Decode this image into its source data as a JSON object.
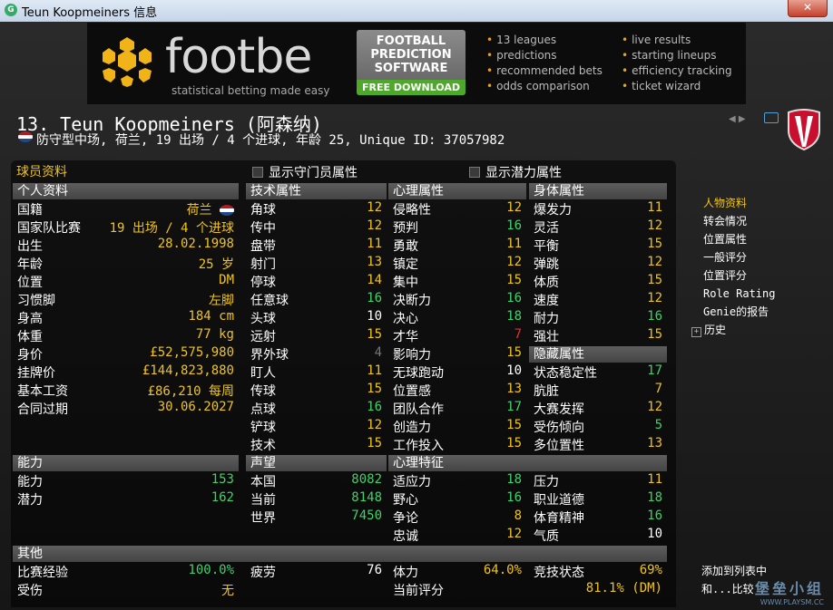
{
  "window": {
    "title": "Teun Koopmeiners 信息",
    "close_glyph": "✕",
    "app_icon_text": "G"
  },
  "banner": {
    "brand": "footbe",
    "tagline": "statistical betting made easy",
    "ad_lines": [
      "FOOTBALL",
      "PREDICTION",
      "SOFTWARE"
    ],
    "ad_download": "FREE DOWNLOAD",
    "features_left": [
      "13 leagues",
      "predictions",
      "recommended bets",
      "odds comparison"
    ],
    "features_right": [
      "live results",
      "starting lineups",
      "efficiency tracking",
      "ticket wizard"
    ]
  },
  "player": {
    "title": "13. Teun Koopmeiners (阿森纳)",
    "info": "防守型中场, 荷兰, 19 出场 / 4 个进球, 年龄 25, Unique ID: 37057982"
  },
  "section_title": "球员资料",
  "checks": {
    "gk": "显示守门员属性",
    "potential": "显示潜力属性"
  },
  "personal": {
    "header": "个人资料",
    "rows": [
      {
        "label": "国籍",
        "value": "荷兰"
      },
      {
        "label": "国家队比赛",
        "value": "19 出场 / 4 个进球"
      },
      {
        "label": "出生",
        "value": "28.02.1998"
      },
      {
        "label": "年龄",
        "value": "25 岁"
      },
      {
        "label": "位置",
        "value": "DM"
      },
      {
        "label": "习惯脚",
        "value": "左脚"
      },
      {
        "label": "身高",
        "value": "184 cm"
      },
      {
        "label": "体重",
        "value": "77 kg"
      },
      {
        "label": "身价",
        "value": "£52,575,980"
      },
      {
        "label": "挂牌价",
        "value": "£144,823,880"
      },
      {
        "label": "基本工资",
        "value": "£86,210 每周"
      },
      {
        "label": "合同过期",
        "value": "30.06.2027"
      }
    ]
  },
  "technical": {
    "header": "技术属性",
    "rows": [
      {
        "label": "角球",
        "value": "12"
      },
      {
        "label": "传中",
        "value": "12"
      },
      {
        "label": "盘带",
        "value": "11"
      },
      {
        "label": "射门",
        "value": "13"
      },
      {
        "label": "停球",
        "value": "14"
      },
      {
        "label": "任意球",
        "value": "16"
      },
      {
        "label": "头球",
        "value": "10"
      },
      {
        "label": "远射",
        "value": "15"
      },
      {
        "label": "界外球",
        "value": "4"
      },
      {
        "label": "盯人",
        "value": "11"
      },
      {
        "label": "传球",
        "value": "15"
      },
      {
        "label": "点球",
        "value": "16"
      },
      {
        "label": "铲球",
        "value": "12"
      },
      {
        "label": "技术",
        "value": "15"
      }
    ]
  },
  "mental": {
    "header": "心理属性",
    "rows": [
      {
        "label": "侵略性",
        "value": "12"
      },
      {
        "label": "预判",
        "value": "16"
      },
      {
        "label": "勇敢",
        "value": "11"
      },
      {
        "label": "镇定",
        "value": "12"
      },
      {
        "label": "集中",
        "value": "15"
      },
      {
        "label": "决断力",
        "value": "16"
      },
      {
        "label": "决心",
        "value": "18"
      },
      {
        "label": "才华",
        "value": "7"
      },
      {
        "label": "影响力",
        "value": "15"
      },
      {
        "label": "无球跑动",
        "value": "10"
      },
      {
        "label": "位置感",
        "value": "13"
      },
      {
        "label": "团队合作",
        "value": "17"
      },
      {
        "label": "创造力",
        "value": "15"
      },
      {
        "label": "工作投入",
        "value": "15"
      }
    ]
  },
  "physical": {
    "header": "身体属性",
    "rows": [
      {
        "label": "爆发力",
        "value": "11"
      },
      {
        "label": "灵活",
        "value": "12"
      },
      {
        "label": "平衡",
        "value": "15"
      },
      {
        "label": "弹跳",
        "value": "12"
      },
      {
        "label": "体质",
        "value": "15"
      },
      {
        "label": "速度",
        "value": "12"
      },
      {
        "label": "耐力",
        "value": "16"
      },
      {
        "label": "强壮",
        "value": "15"
      }
    ]
  },
  "hidden": {
    "header": "隐藏属性",
    "rows": [
      {
        "label": "状态稳定性",
        "value": "17"
      },
      {
        "label": "肮脏",
        "value": "7"
      },
      {
        "label": "大赛发挥",
        "value": "12"
      },
      {
        "label": "受伤倾向",
        "value": "5"
      },
      {
        "label": "多位置性",
        "value": "13"
      }
    ]
  },
  "ability": {
    "header": "能力",
    "rows": [
      {
        "label": "能力",
        "value": "153"
      },
      {
        "label": "潜力",
        "value": "162"
      }
    ]
  },
  "reputation": {
    "header": "声望",
    "rows": [
      {
        "label": "本国",
        "value": "8082"
      },
      {
        "label": "当前",
        "value": "8148"
      },
      {
        "label": "世界",
        "value": "7450"
      }
    ]
  },
  "mental_traits": {
    "header": "心理特征",
    "rows_left": [
      {
        "label": "适应力",
        "value": "18"
      },
      {
        "label": "野心",
        "value": "16"
      },
      {
        "label": "争论",
        "value": "8"
      },
      {
        "label": "忠诚",
        "value": "12"
      }
    ],
    "rows_right": [
      {
        "label": "压力",
        "value": "11"
      },
      {
        "label": "职业道德",
        "value": "18"
      },
      {
        "label": "体育精神",
        "value": "16"
      },
      {
        "label": "气质",
        "value": "10"
      }
    ]
  },
  "other": {
    "header": "其他",
    "exp_label": "比赛经验",
    "exp_value": "100.0%",
    "injury_label": "受伤",
    "injury_value": "无",
    "fatigue_label": "疲劳",
    "fatigue_value": "76",
    "stamina_label": "体力",
    "stamina_value": "64.0%",
    "rating_label": "当前评分",
    "rating_value": "81.1% (DM)",
    "form_label": "竞技状态",
    "form_value": "69%"
  },
  "sidebar": {
    "items": [
      "人物资料",
      "转会情况",
      "位置属性",
      "一般评分",
      "位置评分",
      "Role Rating",
      "Genie的报告",
      "历史"
    ],
    "expand_glyph": "+",
    "add_to_list": "添加到列表中",
    "compare": "和...比较"
  },
  "watermark": {
    "main": "堡垒小组",
    "url": "WWW.PLAYSM.CC"
  },
  "colors": {
    "accent_yellow": "#f0c419",
    "green": "#3fd26a",
    "red": "#e23030",
    "header_gray": "#555555"
  }
}
